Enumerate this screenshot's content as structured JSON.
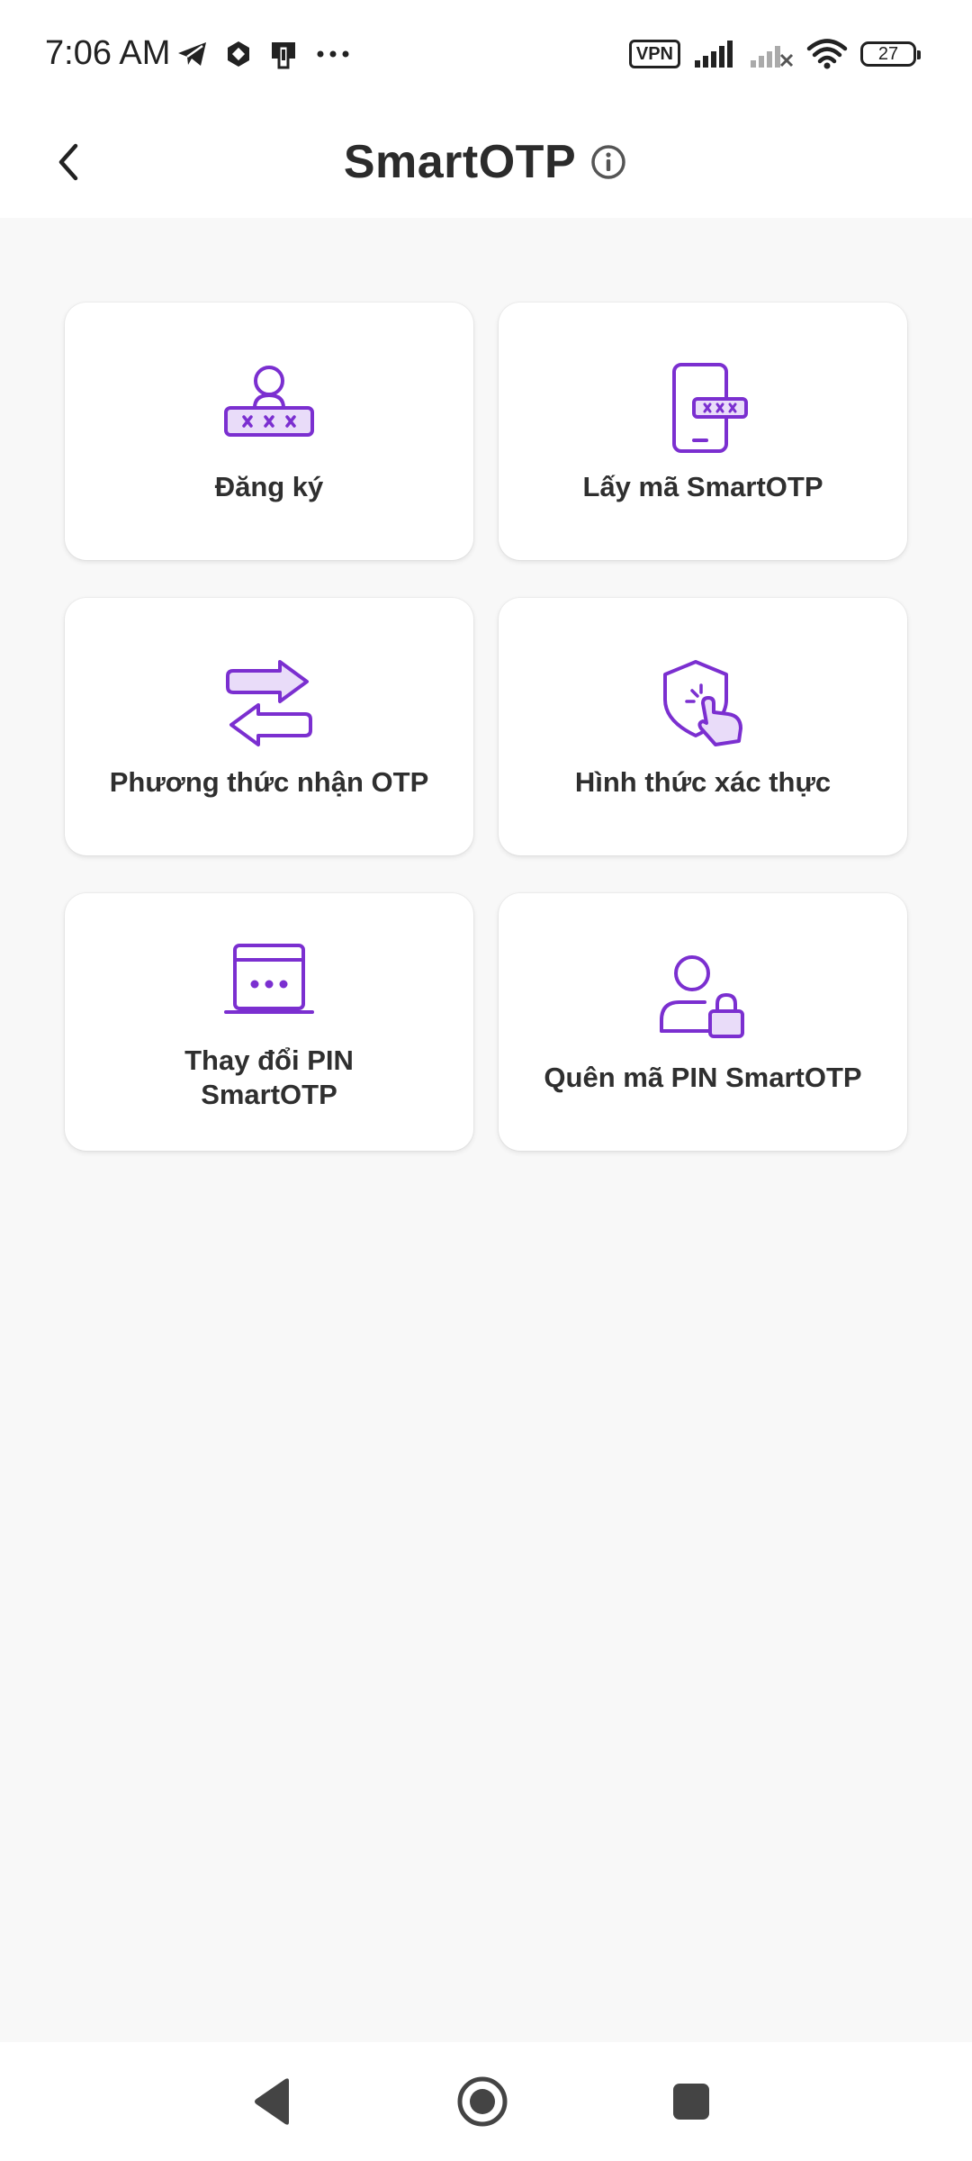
{
  "status_bar": {
    "time": "7:06 AM",
    "left_icons": [
      "telegram-icon",
      "hexagon-app-icon",
      "device-app-icon",
      "more-dots-icon"
    ],
    "vpn_label": "VPN",
    "battery_level": "27",
    "right_icons": [
      "signal-icon",
      "signal-no-service-icon",
      "wifi-icon"
    ]
  },
  "header": {
    "title": "SmartOTP",
    "back_icon": "chevron-left-icon",
    "info_icon": "info-circle-icon"
  },
  "menu": {
    "accent_color": "#7b2fd0",
    "items": [
      {
        "label": "Đăng ký",
        "icon": "user-password-icon"
      },
      {
        "label": "Lấy mã SmartOTP",
        "icon": "phone-otp-icon"
      },
      {
        "label": "Phương thức nhận OTP",
        "icon": "transfer-arrows-icon"
      },
      {
        "label": "Hình thức xác thực",
        "icon": "shield-touch-icon"
      },
      {
        "label": "Thay đổi PIN\nSmartOTP",
        "icon": "pin-screen-icon"
      },
      {
        "label": "Quên mã PIN SmartOTP",
        "icon": "user-lock-icon"
      }
    ]
  },
  "nav_bar": {
    "buttons": [
      "back-triangle-icon",
      "home-circle-icon",
      "recents-square-icon"
    ]
  }
}
